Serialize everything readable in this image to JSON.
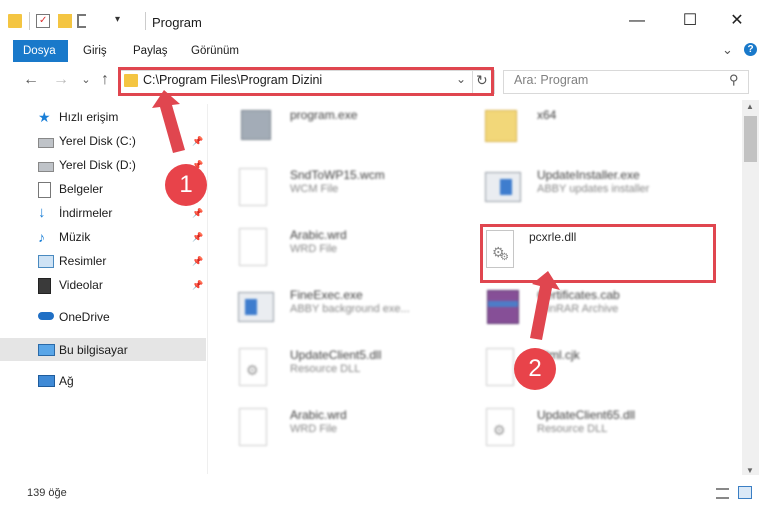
{
  "window": {
    "title": "Program",
    "minimize_glyph": "—",
    "maximize_glyph": "☐",
    "close_glyph": "✕"
  },
  "ribbon": {
    "tabs": [
      "Dosya",
      "Giriş",
      "Paylaş",
      "Görünüm"
    ],
    "expand_glyph": "⌄",
    "help_glyph": "?"
  },
  "navigation": {
    "back_glyph": "←",
    "forward_glyph": "→",
    "recent_glyph": "⌄",
    "up_glyph": "↑",
    "address_path": "C:\\Program Files\\Program Dizini",
    "dropdown_glyph": "⌄",
    "refresh_glyph": "↻",
    "search_placeholder": "Ara: Program",
    "search_glyph": "⚲"
  },
  "sidebar": {
    "items": [
      {
        "label": "Hızlı erişim",
        "icon": "star-icon"
      },
      {
        "label": "Yerel Disk (C:)",
        "icon": "drive-icon"
      },
      {
        "label": "Yerel Disk (D:)",
        "icon": "drive-icon"
      },
      {
        "label": "Belgeler",
        "icon": "documents-icon"
      },
      {
        "label": "İndirmeler",
        "icon": "download-icon"
      },
      {
        "label": "Müzik",
        "icon": "music-icon"
      },
      {
        "label": "Resimler",
        "icon": "pictures-icon"
      },
      {
        "label": "Videolar",
        "icon": "videos-icon"
      },
      {
        "label": "OneDrive",
        "icon": "cloud-icon"
      },
      {
        "label": "Bu bilgisayar",
        "icon": "computer-icon"
      },
      {
        "label": "Ağ",
        "icon": "network-icon"
      }
    ],
    "pin_glyph": "📌"
  },
  "files": [
    {
      "name": "program.exe",
      "type": ""
    },
    {
      "name": "x64",
      "type": ""
    },
    {
      "name": "SndToWP15.wcm",
      "type": "WCM File"
    },
    {
      "name": "UpdateInstaller.exe",
      "type": "ABBY updates installer"
    },
    {
      "name": "Arabic.wrd",
      "type": "WRD File"
    },
    {
      "name": "pcxrle.dll",
      "type": ""
    },
    {
      "name": "FineExec.exe",
      "type": "ABBY background exe..."
    },
    {
      "name": "Certificates.cab",
      "type": "WinRAR Archive"
    },
    {
      "name": "UpdateClient5.dll",
      "type": "Resource DLL"
    },
    {
      "name": "Html.cjk",
      "type": "File"
    },
    {
      "name": "Arabic.wrd",
      "type": "WRD File"
    },
    {
      "name": "UpdateClient65.dll",
      "type": "Resource DLL"
    }
  ],
  "status": {
    "item_count": "139 öğe"
  },
  "annotations": {
    "step1": "1",
    "step2": "2",
    "color": "#e0464f"
  }
}
